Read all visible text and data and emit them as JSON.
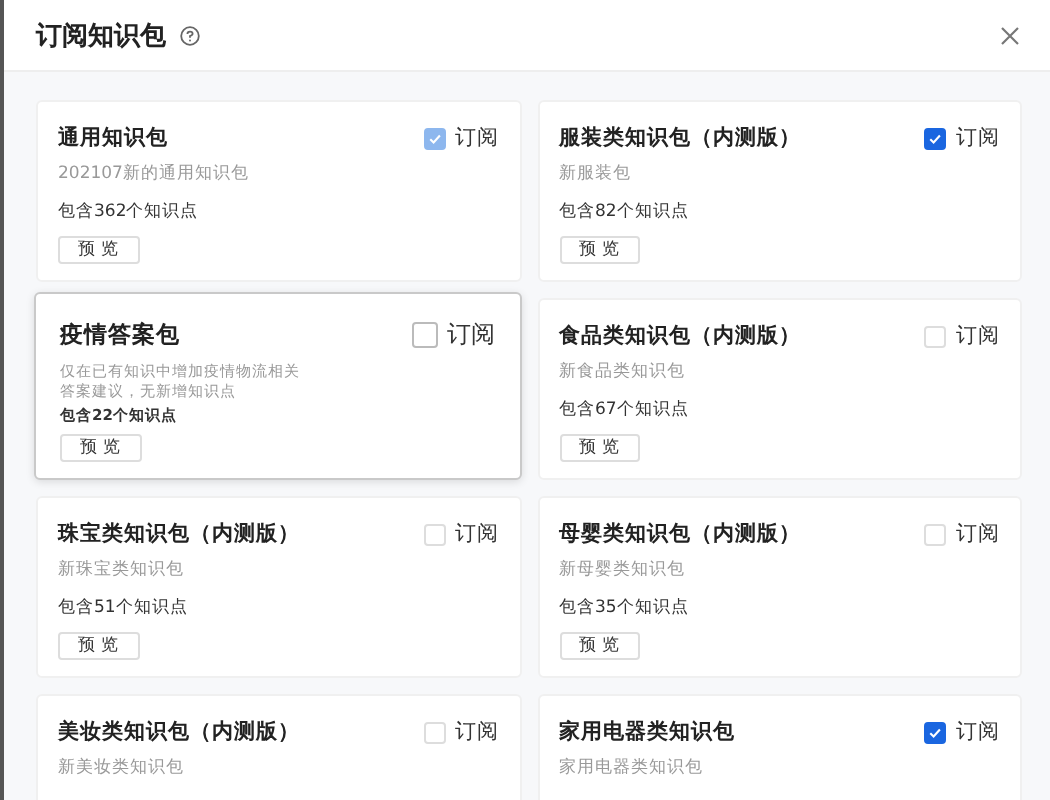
{
  "dialog": {
    "title": "订阅知识包"
  },
  "cards": [
    {
      "title": "通用知识包",
      "description": "202107新的通用知识包",
      "count": "包含362个知识点",
      "subscribe_label": "订阅",
      "checked": true,
      "disabled": true,
      "hovered": false,
      "preview": "预 览"
    },
    {
      "title": "服装类知识包（内测版）",
      "description": "新服装包",
      "count": "包含82个知识点",
      "subscribe_label": "订阅",
      "checked": true,
      "disabled": false,
      "hovered": false,
      "preview": "预 览"
    },
    {
      "title": "疫情答案包",
      "description": "仅在已有知识中增加疫情物流相关答案建议，无新增知识点",
      "count": "包含22个知识点",
      "subscribe_label": "订阅",
      "checked": false,
      "disabled": false,
      "hovered": true,
      "preview": "预 览"
    },
    {
      "title": "食品类知识包（内测版）",
      "description": "新食品类知识包",
      "count": "包含67个知识点",
      "subscribe_label": "订阅",
      "checked": false,
      "disabled": false,
      "hovered": false,
      "preview": "预 览"
    },
    {
      "title": "珠宝类知识包（内测版）",
      "description": "新珠宝类知识包",
      "count": "包含51个知识点",
      "subscribe_label": "订阅",
      "checked": false,
      "disabled": false,
      "hovered": false,
      "preview": "预 览"
    },
    {
      "title": "母婴类知识包（内测版）",
      "description": "新母婴类知识包",
      "count": "包含35个知识点",
      "subscribe_label": "订阅",
      "checked": false,
      "disabled": false,
      "hovered": false,
      "preview": "预 览"
    },
    {
      "title": "美妆类知识包（内测版）",
      "description": "新美妆类知识包",
      "subscribe_label": "订阅",
      "checked": false,
      "disabled": false,
      "hovered": false
    },
    {
      "title": "家用电器类知识包",
      "description": "家用电器类知识包",
      "subscribe_label": "订阅",
      "checked": true,
      "disabled": false,
      "hovered": false
    }
  ]
}
